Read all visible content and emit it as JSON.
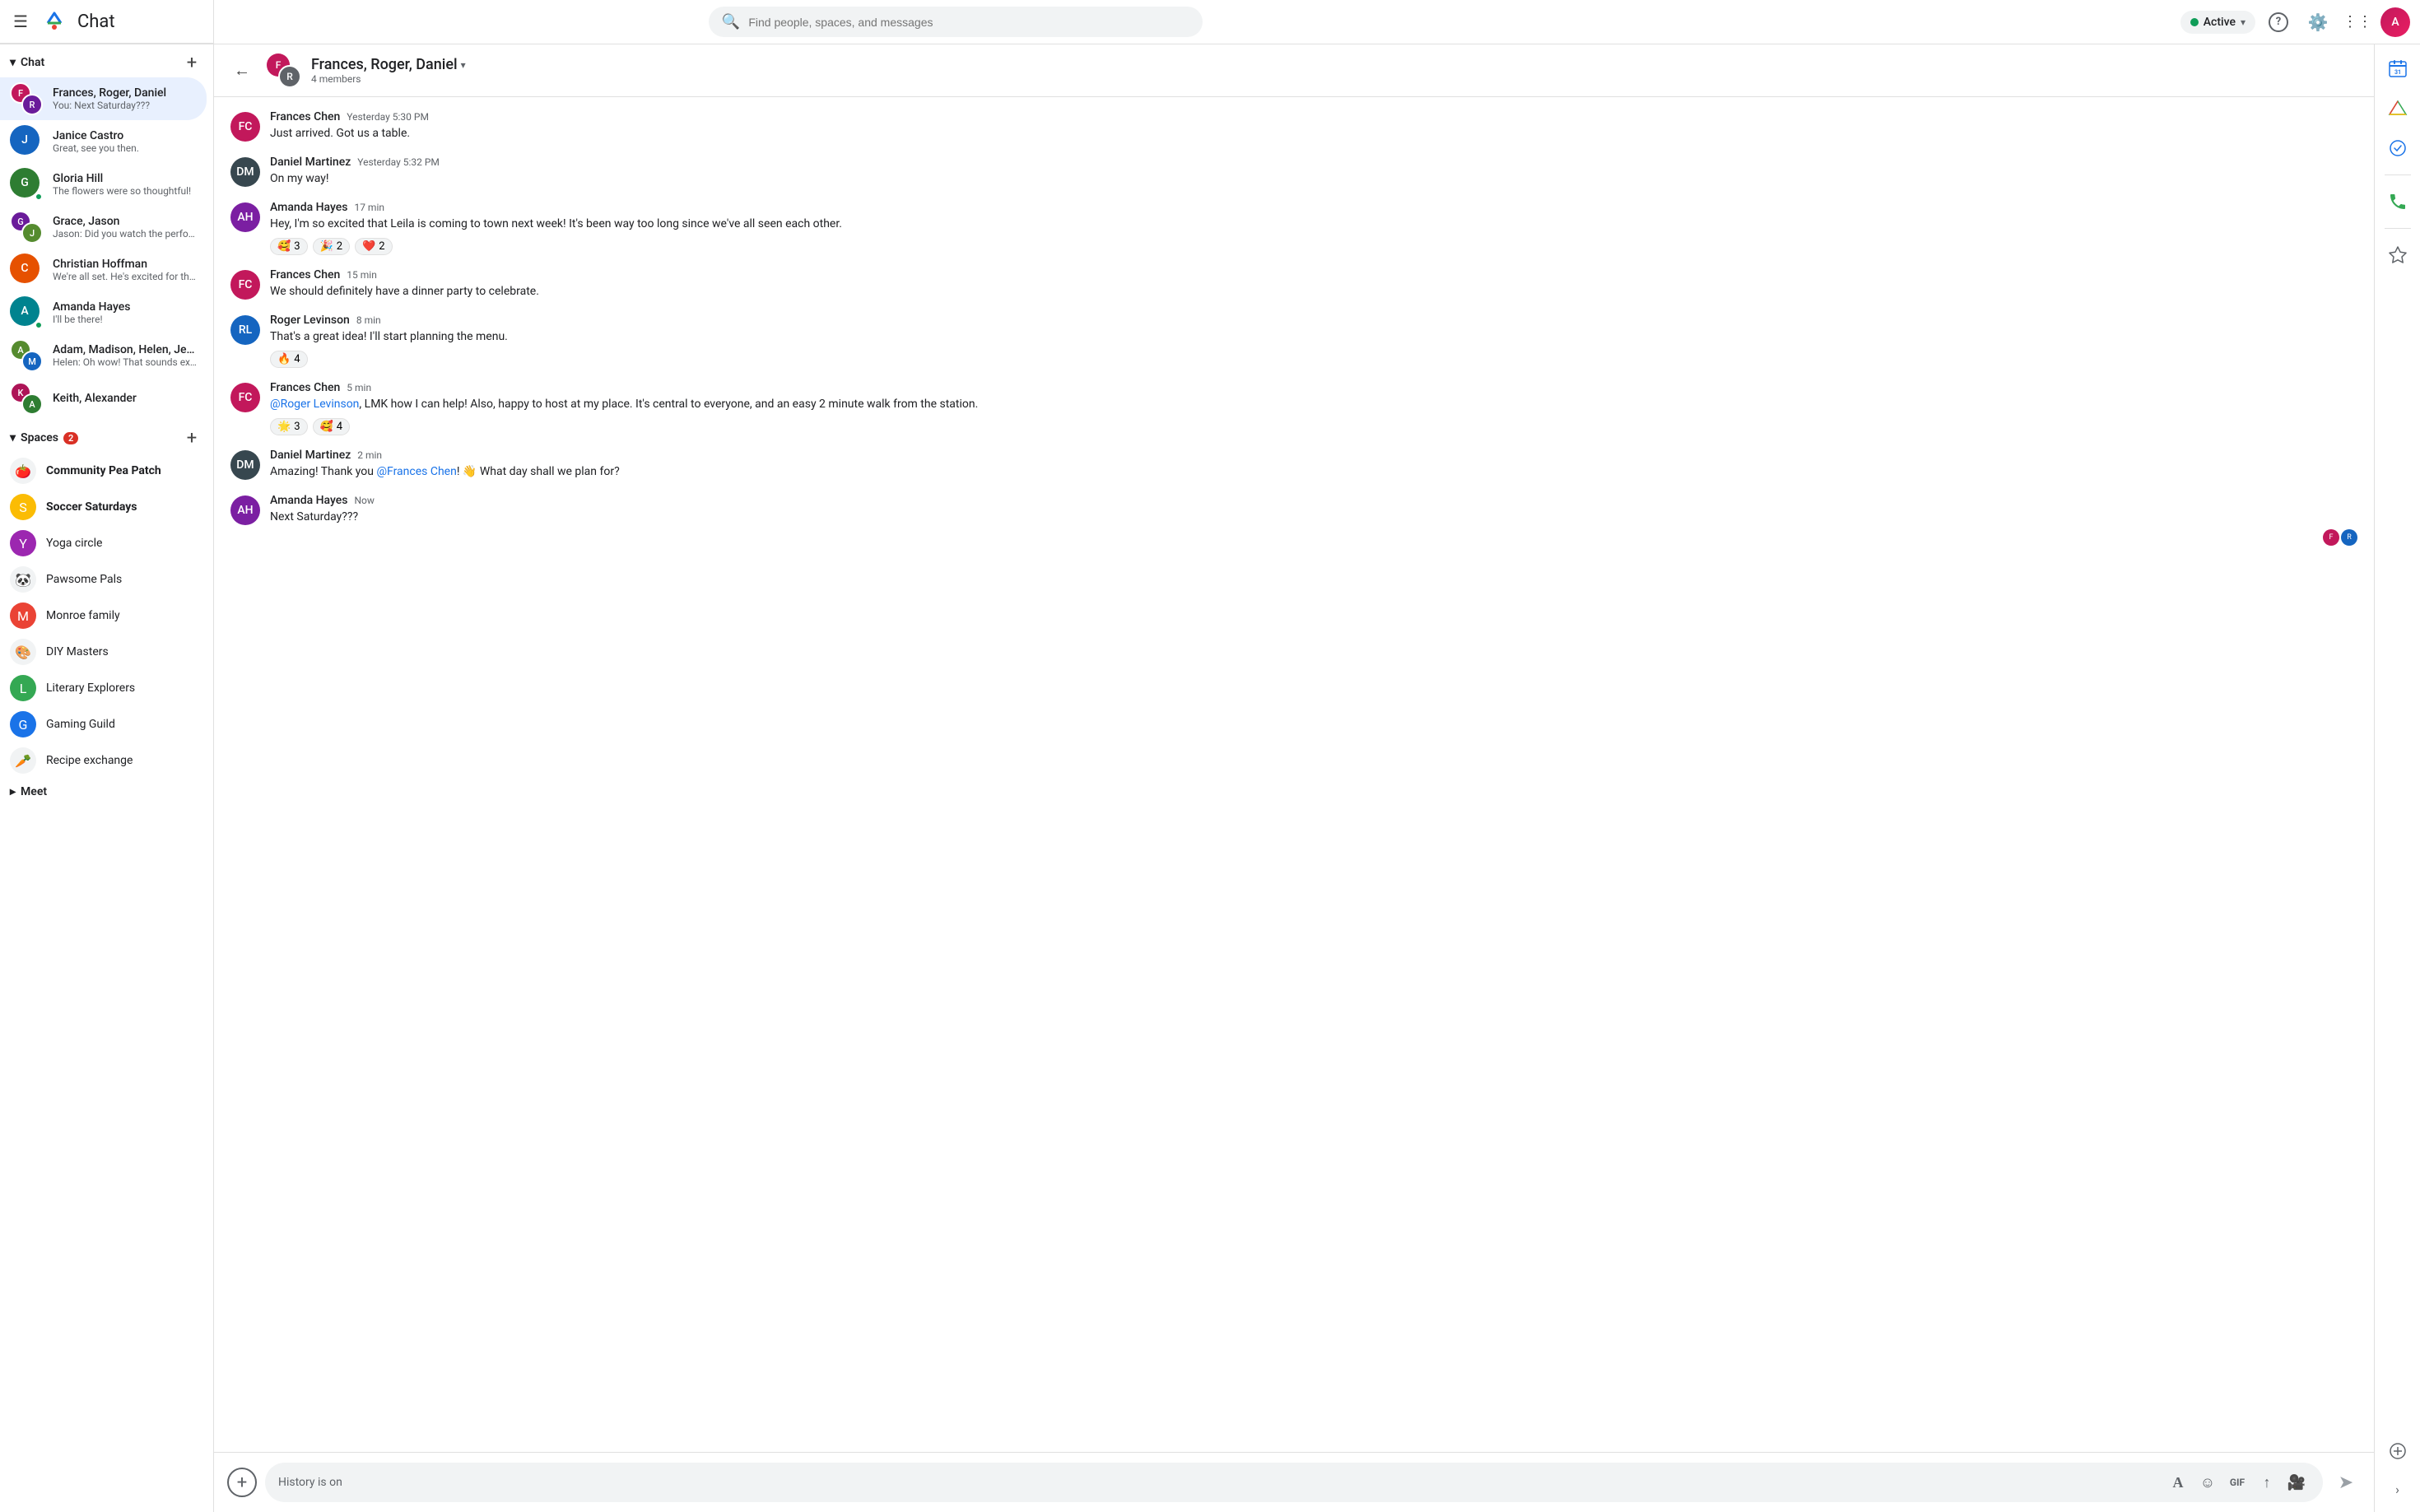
{
  "app": {
    "title": "Chat",
    "logo_color": "#1a73e8"
  },
  "topbar": {
    "search_placeholder": "Find people, spaces, and messages",
    "active_label": "Active",
    "help_icon": "?",
    "settings_icon": "⚙",
    "grid_icon": "⋮⋮⋮"
  },
  "sidebar": {
    "chat_section_label": "Chat",
    "spaces_section_label": "Spaces",
    "spaces_badge": "2",
    "meet_section_label": "Meet",
    "chat_items": [
      {
        "id": "chat-1",
        "name": "Frances, Roger, Daniel",
        "preview": "You: Next Saturday???",
        "active": true,
        "avatar_type": "group"
      },
      {
        "id": "chat-2",
        "name": "Janice Castro",
        "preview": "Great, see you then.",
        "active": false,
        "avatar_type": "single"
      },
      {
        "id": "chat-3",
        "name": "Gloria Hill",
        "preview": "The flowers were so thoughtful!",
        "active": false,
        "avatar_type": "single",
        "has_status": true
      },
      {
        "id": "chat-4",
        "name": "Grace, Jason",
        "preview": "Jason: Did you watch the performan ...",
        "active": false,
        "avatar_type": "group"
      },
      {
        "id": "chat-5",
        "name": "Christian Hoffman",
        "preview": "We're all set.  He's excited for the trip.",
        "active": false,
        "avatar_type": "single"
      },
      {
        "id": "chat-6",
        "name": "Amanda Hayes",
        "preview": "I'll be there!",
        "active": false,
        "avatar_type": "single",
        "has_status": true
      },
      {
        "id": "chat-7",
        "name": "Adam, Madison, Helen, Jeffrey",
        "preview": "Helen: Oh wow! That sounds exciting ...",
        "active": false,
        "avatar_type": "group"
      },
      {
        "id": "chat-8",
        "name": "Keith, Alexander",
        "preview": "",
        "active": false,
        "avatar_type": "group"
      }
    ],
    "spaces": [
      {
        "id": "space-1",
        "name": "Community Pea Patch",
        "bold": true,
        "icon": "🍅",
        "icon_bg": "#fff"
      },
      {
        "id": "space-2",
        "name": "Soccer Saturdays",
        "bold": true,
        "icon": "S",
        "icon_bg": "#fbbc04",
        "icon_color": "#fff"
      },
      {
        "id": "space-3",
        "name": "Yoga circle",
        "bold": false,
        "icon": "Y",
        "icon_bg": "#9c27b0",
        "icon_color": "#fff"
      },
      {
        "id": "space-4",
        "name": "Pawsome Pals",
        "bold": false,
        "icon": "🐼",
        "icon_bg": "#fff"
      },
      {
        "id": "space-5",
        "name": "Monroe family",
        "bold": false,
        "icon": "M",
        "icon_bg": "#ea4335",
        "icon_color": "#fff"
      },
      {
        "id": "space-6",
        "name": "DIY Masters",
        "bold": false,
        "icon": "🎨",
        "icon_bg": "#fff"
      },
      {
        "id": "space-7",
        "name": "Literary Explorers",
        "bold": false,
        "icon": "L",
        "icon_bg": "#34a853",
        "icon_color": "#fff"
      },
      {
        "id": "space-8",
        "name": "Gaming Guild",
        "bold": false,
        "icon": "G",
        "icon_bg": "#1a73e8",
        "icon_color": "#fff"
      },
      {
        "id": "space-9",
        "name": "Recipe exchange",
        "bold": false,
        "icon": "🥕",
        "icon_bg": "#fff"
      }
    ]
  },
  "chat_header": {
    "title": "Frances, Roger, Daniel",
    "members": "4 members"
  },
  "messages": [
    {
      "id": "msg-1",
      "sender": "Frances Chen",
      "time": "Yesterday 5:30 PM",
      "text": "Just arrived.  Got us a table.",
      "avatar_color": "#c2185b",
      "reactions": []
    },
    {
      "id": "msg-2",
      "sender": "Daniel Martinez",
      "time": "Yesterday 5:32 PM",
      "text": "On my way!",
      "avatar_color": "#5f6368",
      "reactions": []
    },
    {
      "id": "msg-3",
      "sender": "Amanda Hayes",
      "time": "17 min",
      "text": "Hey, I'm so excited that Leila is coming to town next week! It's been way too long since we've all seen each other.",
      "avatar_color": "#c2185b",
      "reactions": [
        {
          "emoji": "🥰",
          "count": "3"
        },
        {
          "emoji": "🎉",
          "count": "2"
        },
        {
          "emoji": "❤️",
          "count": "2"
        }
      ]
    },
    {
      "id": "msg-4",
      "sender": "Frances Chen",
      "time": "15 min",
      "text": "We should definitely have a dinner party to celebrate.",
      "avatar_color": "#c2185b",
      "reactions": []
    },
    {
      "id": "msg-5",
      "sender": "Roger Levinson",
      "time": "8 min",
      "text": "That's a great idea! I'll start planning the menu.",
      "avatar_color": "#5f6368",
      "reactions": [
        {
          "emoji": "🔥",
          "count": "4"
        }
      ]
    },
    {
      "id": "msg-6",
      "sender": "Frances Chen",
      "time": "5 min",
      "text": "@Roger Levinson, LMK how I can help!  Also, happy to host at my place. It's central to everyone, and an easy 2 minute walk from the station.",
      "avatar_color": "#c2185b",
      "mention": "@Roger Levinson",
      "reactions": [
        {
          "emoji": "🌟",
          "count": "3"
        },
        {
          "emoji": "🥰",
          "count": "4"
        }
      ]
    },
    {
      "id": "msg-7",
      "sender": "Daniel Martinez",
      "time": "2 min",
      "text": "Amazing! Thank you @Frances Chen! 👋 What day shall we plan for?",
      "avatar_color": "#5f6368",
      "mention": "@Frances Chen",
      "reactions": []
    },
    {
      "id": "msg-8",
      "sender": "Amanda Hayes",
      "time": "Now",
      "text": "Next Saturday???",
      "avatar_color": "#c2185b",
      "reactions": []
    }
  ],
  "input": {
    "placeholder": "History is on",
    "format_icon": "A",
    "emoji_icon": "☺",
    "gif_label": "GIF",
    "upload_icon": "↑",
    "video_icon": "▶"
  },
  "right_panel_icons": [
    {
      "id": "rp-calendar",
      "icon": "📅",
      "label": "calendar-icon"
    },
    {
      "id": "rp-drive",
      "icon": "△",
      "label": "drive-icon"
    },
    {
      "id": "rp-tasks",
      "icon": "☑",
      "label": "tasks-icon"
    },
    {
      "id": "rp-meet",
      "icon": "📞",
      "label": "meet-icon"
    },
    {
      "id": "rp-chat-circle",
      "icon": "◎",
      "label": "chat-circle-icon"
    },
    {
      "id": "rp-star",
      "icon": "☆",
      "label": "star-icon"
    },
    {
      "id": "rp-add",
      "icon": "+",
      "label": "add-icon"
    }
  ]
}
